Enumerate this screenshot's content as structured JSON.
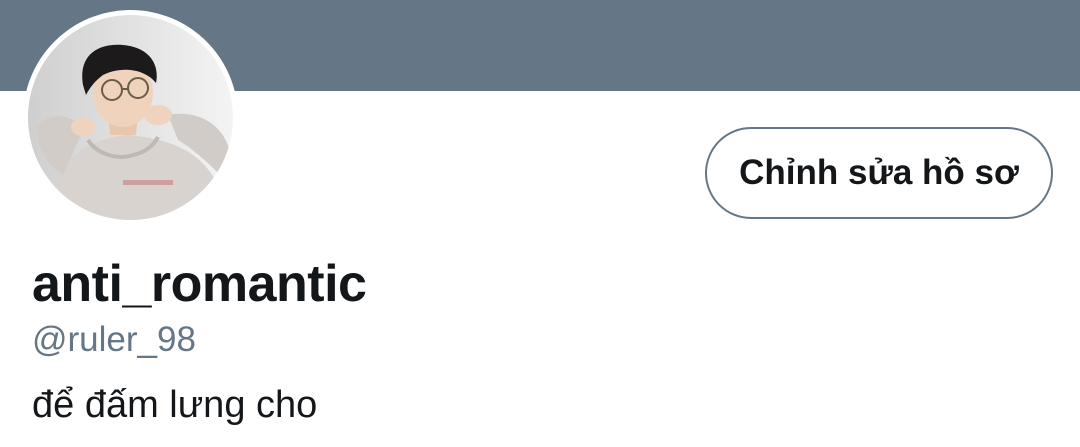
{
  "profile": {
    "display_name": "anti_romantic",
    "handle": "@ruler_98",
    "bio": "để đấm lưng cho",
    "edit_profile_label": "Chỉnh sửa hồ sơ"
  },
  "icons": {
    "avatar": "user-photo"
  },
  "colors": {
    "banner": "#657786",
    "text_primary": "#14171a",
    "text_secondary": "#657786",
    "button_border": "#657786"
  }
}
